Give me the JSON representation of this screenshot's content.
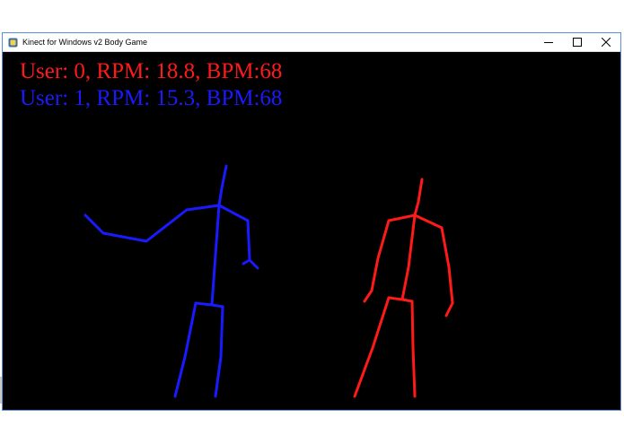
{
  "window": {
    "title": "Kinect for Windows v2 Body Game",
    "icons": {
      "app": "python-pygame-icon",
      "minimize": "minimize-icon",
      "maximize": "maximize-icon",
      "close": "close-icon"
    }
  },
  "users": [
    {
      "label": "User: 0, RPM: 18.8, BPM:68",
      "color": "#ff1a1a"
    },
    {
      "label": "User: 1, RPM: 15.3, BPM:68",
      "color": "#1a1aff"
    }
  ]
}
